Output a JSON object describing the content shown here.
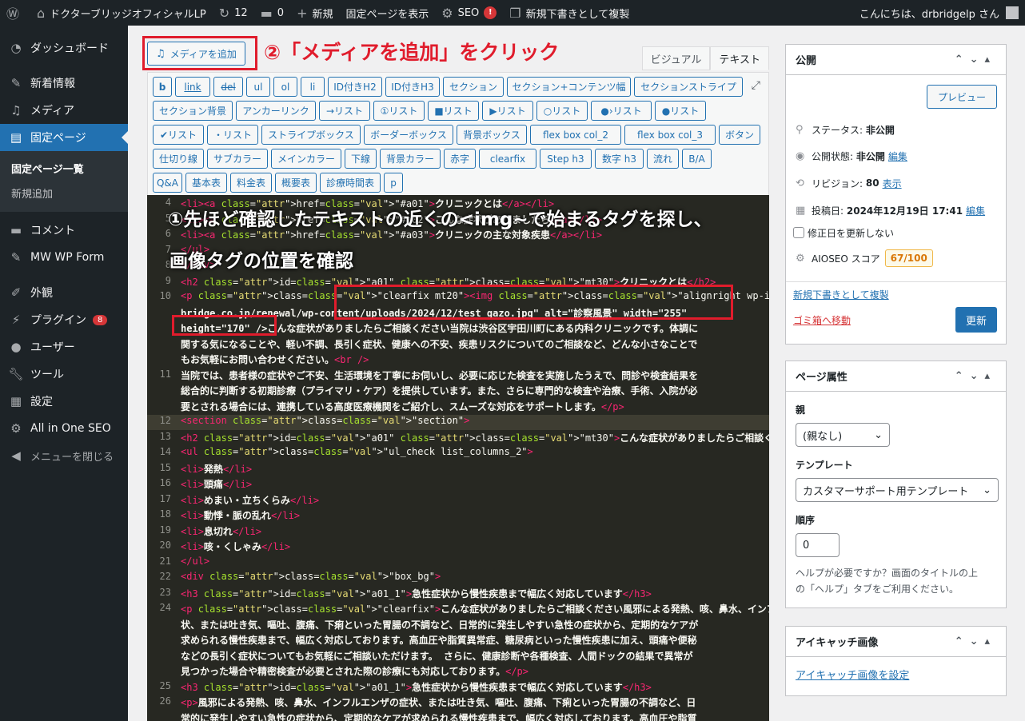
{
  "adminbar": {
    "site_name": "ドクターブリッジオフィシャルLP",
    "updates": "12",
    "comments": "0",
    "new_label": "新規",
    "view_page": "固定ページを表示",
    "seo": "SEO",
    "seo_badge": "!",
    "duplicate": "新規下書きとして複製",
    "greeting": "こんにちは、drbridgelp さん"
  },
  "sidebar": {
    "items": [
      {
        "label": "ダッシュボード",
        "icon": "gauge-icon"
      },
      {
        "label": "新着情報",
        "icon": "pin-icon"
      },
      {
        "label": "メディア",
        "icon": "media-icon"
      },
      {
        "label": "固定ページ",
        "icon": "page-icon"
      },
      {
        "label": "コメント",
        "icon": "comment-icon"
      },
      {
        "label": "MW WP Form",
        "icon": "pin-icon"
      },
      {
        "label": "外観",
        "icon": "brush-icon"
      },
      {
        "label": "プラグイン",
        "icon": "plugin-icon",
        "badge": "8"
      },
      {
        "label": "ユーザー",
        "icon": "user-icon"
      },
      {
        "label": "ツール",
        "icon": "wrench-icon"
      },
      {
        "label": "設定",
        "icon": "settings-icon"
      },
      {
        "label": "All in One SEO",
        "icon": "seo-icon"
      }
    ],
    "sub_pages": [
      "固定ページ一覧",
      "新規追加"
    ],
    "collapse": "メニューを閉じる"
  },
  "editor": {
    "media_button": "メディアを追加",
    "tab_visual": "ビジュアル",
    "tab_text": "テキスト",
    "annotation_2": "②「メディアを追加」をクリック",
    "annotation_1_line1": "①先ほど確認したテキストの近くの<img~で始まるタグを探し、",
    "annotation_1_line2": "画像タグの位置を確認",
    "quicktags": [
      [
        "b",
        "link",
        "del",
        "ul",
        "ol",
        "li",
        "ID付きH2",
        "ID付きH3",
        "セクション",
        "セクション+コンテンツ幅",
        "セクションストライプ"
      ],
      [
        "セクション背景",
        "アンカーリンク",
        "→リスト",
        "①リスト",
        "■リスト",
        "▶リスト",
        "○リスト",
        "●›リスト",
        "●リスト"
      ],
      [
        "✔リスト",
        "・リスト",
        "ストライプボックス",
        "ボーダーボックス",
        "背景ボックス",
        "flex box col_2",
        "flex box col_3",
        "ボタン"
      ],
      [
        "仕切り線",
        "サブカラー",
        "メインカラー",
        "下線",
        "背景カラー",
        "赤字",
        "clearfix",
        "Step h3",
        "数字 h3",
        "流れ",
        "B/A"
      ],
      [
        "Q&A",
        "基本表",
        "料金表",
        "概要表",
        "診療時間表",
        "p"
      ]
    ]
  },
  "code_lines": [
    {
      "n": "4",
      "t": "<li><a href=\"#a01\">クリニックとは</a></li>"
    },
    {
      "n": "5",
      "t": "<li><a href=\"#a02\">こんな症状がありましたら</a></li>"
    },
    {
      "n": "6",
      "t": "<li><a href=\"#a03\">クリニックの主な対象疾患</a></li>"
    },
    {
      "n": "7",
      "t": "</ul>"
    },
    {
      "n": "8",
      "t": "</div>"
    },
    {
      "n": "9",
      "t": "<h2 id=\"a01\" class=\"mt30\">クリニックとは</h2>"
    },
    {
      "n": "10",
      "t": "<p class=\"clearfix mt20\"><img class=\"alignright wp-image-451 \" src=\"https://www.dr-"
    },
    {
      "n": "",
      "t": "bridge.co.jp/renewal/wp-content/uploads/2024/12/test_gazo.jpg\" alt=\"診察風景\" width=\"255\""
    },
    {
      "n": "",
      "t": "height=\"170\" />こんな症状がありましたらご相談ください当院は渋谷区宇田川町にある内科クリニックです。体調に"
    },
    {
      "n": "",
      "t": "関する気になることや、軽い不調、長引く症状、健康への不安、疾患リスクについてのご相談など、どんな小さなことで"
    },
    {
      "n": "",
      "t": "もお気軽にお問い合わせください。<br />"
    },
    {
      "n": "11",
      "t": "当院では、患者様の症状やご不安、生活環境を丁寧にお伺いし、必要に応じた検査を実施したうえで、問診や検査結果を"
    },
    {
      "n": "",
      "t": "総合的に判断する初期診療（プライマリ・ケア）を提供しています。また、さらに専門的な検査や治療、手術、入院が必"
    },
    {
      "n": "",
      "t": "要とされる場合には、連携している高度医療機関をご紹介し、スムーズな対応をサポートします。</p>"
    },
    {
      "n": "12",
      "t": "<section class=\"section\">"
    },
    {
      "n": "13",
      "t": "<h2 id=\"a01\" class=\"mt30\">こんな症状がありましたらご相談ください</h2>"
    },
    {
      "n": "14",
      "t": "<ul class=\"ul_check list_columns_2\">"
    },
    {
      "n": "15",
      "t": "  <li>発熱</li>"
    },
    {
      "n": "16",
      "t": "  <li>頭痛</li>"
    },
    {
      "n": "17",
      "t": "  <li>めまい・立ちくらみ</li>"
    },
    {
      "n": "18",
      "t": "  <li>動悸・脈の乱れ</li>"
    },
    {
      "n": "19",
      "t": "  <li>息切れ</li>"
    },
    {
      "n": "20",
      "t": "  <li>咳・くしゃみ</li>"
    },
    {
      "n": "21",
      "t": "</ul>"
    },
    {
      "n": "22",
      "t": "<div class=\"box_bg\">"
    },
    {
      "n": "23",
      "t": "<h3 id=\"a01_1\">急性症状から慢性疾患まで幅広く対応しています</h3>"
    },
    {
      "n": "24",
      "t": "<p class=\"clearfix\">こんな症状がありましたらご相談ください風邪による発熱、咳、鼻水、インフルエンザの症"
    },
    {
      "n": "",
      "t": "状、または吐き気、嘔吐、腹痛、下痢といった胃腸の不調など、日常的に発生しやすい急性の症状から、定期的なケアが"
    },
    {
      "n": "",
      "t": "求められる慢性疾患まで、幅広く対応しております。高血圧や脂質異常症、糖尿病といった慢性疾患に加え、頭痛や便秘"
    },
    {
      "n": "",
      "t": "などの長引く症状についてもお気軽にご相談いただけます。 さらに、健康診断や各種検査、人間ドックの結果で異常が"
    },
    {
      "n": "",
      "t": "見つかった場合や精密検査が必要とされた際の診療にも対応しております。</p>"
    },
    {
      "n": "25",
      "t": "<h3 id=\"a01_1\">急性症状から慢性疾患まで幅広く対応しています</h3>"
    },
    {
      "n": "26",
      "t": "<p>風邪による発熱、咳、鼻水、インフルエンザの症状、または吐き気、嘔吐、腹痛、下痢といった胃腸の不調など、日"
    },
    {
      "n": "",
      "t": "常的に発生しやすい急性の症状から、定期的なケアが求められる慢性疾患まで、幅広く対応しております。高血圧や脂質"
    }
  ],
  "publish": {
    "title": "公開",
    "preview": "プレビュー",
    "status_label": "ステータス:",
    "status_value": "非公開",
    "visibility_label": "公開状態:",
    "visibility_value": "非公開",
    "edit": "編集",
    "revision_label": "リビジョン:",
    "revision_value": "80",
    "revision_link": "表示",
    "date_label": "投稿日:",
    "date_value": "2024年12月19日 17:41",
    "update_date": "修正日を更新しない",
    "aioseo_label": "AIOSEO スコア",
    "aioseo_score": "67/100",
    "duplicate": "新規下書きとして複製",
    "trash": "ゴミ箱へ移動",
    "update": "更新"
  },
  "page_attributes": {
    "title": "ページ属性",
    "parent_label": "親",
    "parent_value": "(親なし)",
    "template_label": "テンプレート",
    "template_value": "カスタマーサポート用テンプレート",
    "order_label": "順序",
    "order_value": "0",
    "help_text_1": "ヘルプが必要ですか？画面のタイトルの上",
    "help_text_2": "の「ヘルプ」タブをご利用ください。"
  },
  "featured_image": {
    "title": "アイキャッチ画像",
    "set_link": "アイキャッチ画像を設定"
  },
  "colors": {
    "accent": "#2271b1",
    "annotation_red": "#e01c2c",
    "adminbar_bg": "#1d2327"
  }
}
